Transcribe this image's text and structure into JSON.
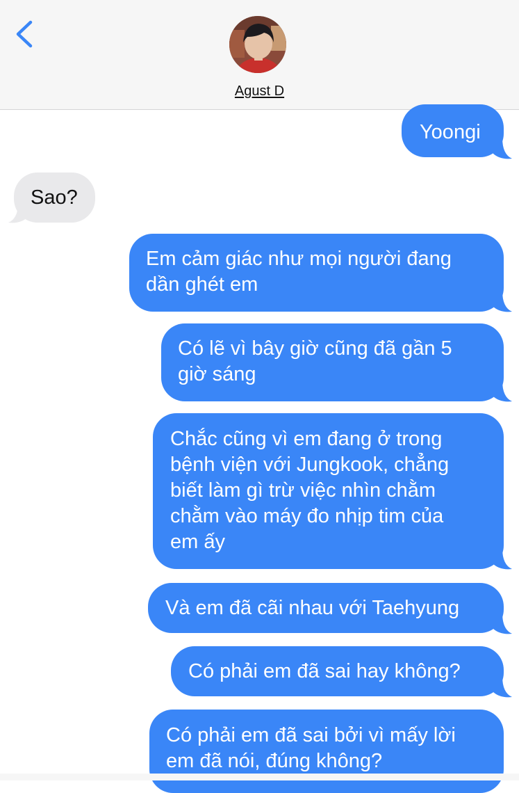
{
  "header": {
    "contact_name": "Agust D",
    "back_icon": "chevron-left-icon"
  },
  "colors": {
    "outgoing_bubble": "#3a86f7",
    "incoming_bubble": "#e9e9eb",
    "back_arrow": "#3a86f7"
  },
  "messages": [
    {
      "from": "me",
      "lines": [
        "Yoongi"
      ]
    },
    {
      "from": "contact",
      "lines": [
        "Sao?"
      ]
    },
    {
      "from": "me",
      "lines": [
        "Em cảm giác như mọi người đang",
        "dần ghét em"
      ]
    },
    {
      "from": "me",
      "lines": [
        "Có lẽ vì bây giờ cũng đã gần 5",
        "giờ sáng"
      ]
    },
    {
      "from": "me",
      "lines": [
        "Chắc cũng vì em đang ở trong",
        "bệnh viện với Jungkook, chẳng",
        "biết làm gì trừ việc nhìn chằm",
        "chằm vào máy đo nhịp tim của",
        "em ấy"
      ]
    },
    {
      "from": "me",
      "lines": [
        "Và em đã cãi nhau với Taehyung"
      ]
    },
    {
      "from": "me",
      "lines": [
        "Có phải em đã sai hay không?"
      ]
    },
    {
      "from": "me",
      "lines": [
        "Có phải em đã sai bởi vì mấy lời",
        "em đã nói, đúng không?"
      ]
    }
  ]
}
